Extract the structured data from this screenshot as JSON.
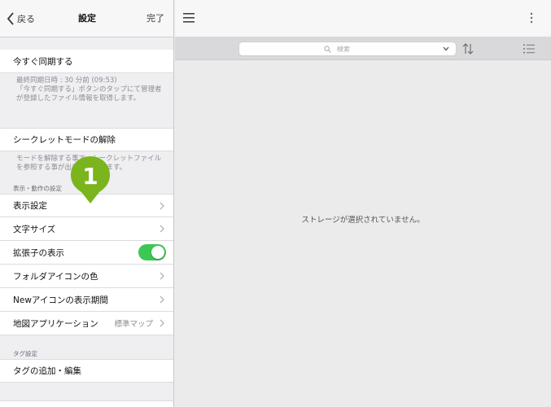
{
  "nav": {
    "back_label": "戻る",
    "title": "設定",
    "done_label": "完了"
  },
  "sync": {
    "label": "今すぐ同期する",
    "note_line1": "最終同期日時 : 30 分前 (09:53)",
    "note_line2": "「今すぐ同期する」ボタンのタップにて管理者",
    "note_line3": "が登録したファイル情報を取得します。"
  },
  "secret": {
    "label": "シークレットモードの解除",
    "note_line1": "モードを解除する事で、シークレットファイル",
    "note_line2": "を参照する事が出来なくなります。"
  },
  "display_section": {
    "header": "表示・動作の設定",
    "items": [
      {
        "label": "表示設定"
      },
      {
        "label": "文字サイズ"
      },
      {
        "label": "拡張子の表示",
        "toggle": true
      },
      {
        "label": "フォルダアイコンの色"
      },
      {
        "label": "Newアイコンの表示期間"
      },
      {
        "label": "地図アプリケーション",
        "value": "標準マップ"
      }
    ]
  },
  "tag_section": {
    "header": "タグ設定",
    "items": [
      {
        "label": "タグの追加・編集"
      }
    ]
  },
  "marker": {
    "number": "1",
    "color": "#7bb51e"
  },
  "right": {
    "search_placeholder": "検索",
    "empty_message": "ストレージが選択されていません。"
  },
  "colors": {
    "toggle_on": "#3cc854"
  }
}
